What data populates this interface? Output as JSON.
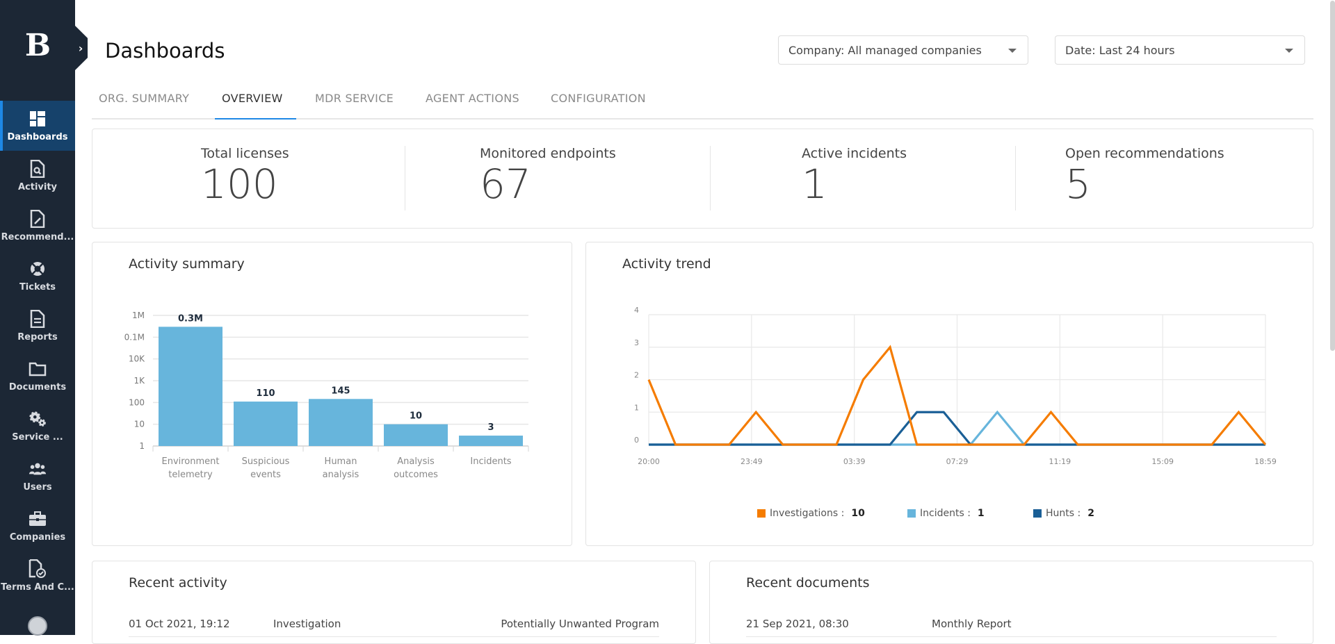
{
  "app": {
    "logo_letter": "B",
    "collapse_icon": "chevron-right-icon"
  },
  "sidebar": {
    "items": [
      {
        "label": "Dashboards",
        "icon": "dashboard-icon",
        "active": true
      },
      {
        "label": "Activity",
        "icon": "file-search-icon"
      },
      {
        "label": "Recommend...",
        "icon": "file-edit-icon"
      },
      {
        "label": "Tickets",
        "icon": "lifebuoy-icon"
      },
      {
        "label": "Reports",
        "icon": "report-icon"
      },
      {
        "label": "Documents",
        "icon": "folder-icon"
      },
      {
        "label": "Service ...",
        "icon": "gears-icon"
      },
      {
        "label": "Users",
        "icon": "users-icon"
      },
      {
        "label": "Companies",
        "icon": "briefcase-icon"
      },
      {
        "label": "Terms And C...",
        "icon": "file-check-icon"
      }
    ],
    "avatar_icon": "astronaut-avatar-icon"
  },
  "header": {
    "title": "Dashboards",
    "company_filter": "Company: All managed companies",
    "date_filter": "Date: Last 24 hours"
  },
  "tabs": [
    {
      "label": "ORG. SUMMARY"
    },
    {
      "label": "OVERVIEW",
      "active": true
    },
    {
      "label": "MDR SERVICE"
    },
    {
      "label": "AGENT ACTIONS"
    },
    {
      "label": "CONFIGURATION"
    }
  ],
  "kpis": [
    {
      "label": "Total licenses",
      "value": "100"
    },
    {
      "label": "Monitored endpoints",
      "value": "67"
    },
    {
      "label": "Active incidents",
      "value": "1"
    },
    {
      "label": "Open recommendations",
      "value": "5"
    }
  ],
  "colors": {
    "bar": "#67b5dc",
    "investigations": "#f57c00",
    "incidents": "#67b5dc",
    "hunts": "#1a5f96",
    "accent": "#1e88e5",
    "sidebar_bg": "#1c2735",
    "sidebar_active": "#16426b"
  },
  "chart_data": [
    {
      "type": "bar",
      "title": "Activity summary",
      "yscale": "log",
      "ylim": [
        1,
        1000000
      ],
      "yticks": [
        "1",
        "10",
        "100",
        "1K",
        "10K",
        "0.1M",
        "1M"
      ],
      "categories": [
        [
          "Environment",
          "telemetry"
        ],
        [
          "Suspicious",
          "events"
        ],
        [
          "Human",
          "analysis"
        ],
        [
          "Analysis",
          "outcomes"
        ],
        [
          "Incidents"
        ]
      ],
      "values": [
        300000,
        110,
        145,
        10,
        3
      ],
      "data_labels": [
        "0.3M",
        "110",
        "145",
        "10",
        "3"
      ],
      "grid": true
    },
    {
      "type": "line",
      "title": "Activity trend",
      "ylim": [
        0,
        4
      ],
      "yticks": [
        "0",
        "1",
        "2",
        "3",
        "4"
      ],
      "xticks": [
        "20:00",
        "23:49",
        "03:39",
        "07:29",
        "11:19",
        "15:09",
        "18:59"
      ],
      "x_points": 24,
      "grid": true,
      "legend_position": "bottom",
      "series": [
        {
          "name": "Investigations",
          "total": "10",
          "key": "investigations",
          "values": [
            2,
            0,
            0,
            0,
            1,
            0,
            0,
            0,
            2,
            3,
            0,
            0,
            0,
            0,
            0,
            1,
            0,
            0,
            0,
            0,
            0,
            0,
            1,
            0
          ]
        },
        {
          "name": "Incidents",
          "total": "1",
          "key": "incidents",
          "values": [
            0,
            0,
            0,
            0,
            0,
            0,
            0,
            0,
            0,
            0,
            0,
            0,
            0,
            1,
            0,
            0,
            0,
            0,
            0,
            0,
            0,
            0,
            0,
            0
          ]
        },
        {
          "name": "Hunts",
          "total": "2",
          "key": "hunts",
          "values": [
            0,
            0,
            0,
            0,
            0,
            0,
            0,
            0,
            0,
            0,
            1,
            1,
            0,
            0,
            0,
            0,
            0,
            0,
            0,
            0,
            0,
            0,
            0,
            0
          ]
        }
      ]
    }
  ],
  "recent_activity": {
    "title": "Recent activity",
    "rows": [
      {
        "date": "01 Oct 2021, 19:12",
        "type": "Investigation",
        "detail": "Potentially Unwanted Program"
      }
    ]
  },
  "recent_documents": {
    "title": "Recent documents",
    "rows": [
      {
        "date": "21 Sep 2021, 08:30",
        "name": "Monthly Report"
      }
    ]
  }
}
